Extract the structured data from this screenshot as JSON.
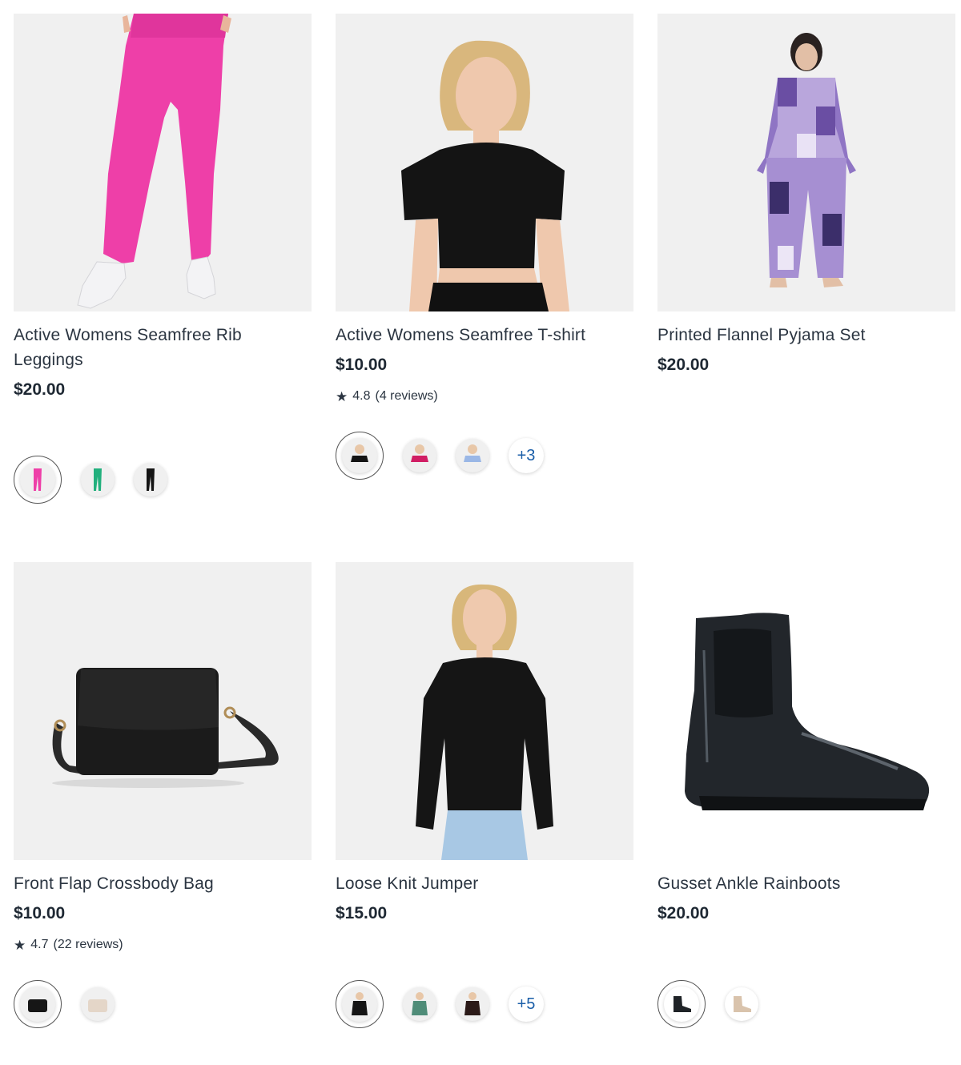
{
  "products": [
    {
      "title": "Active Womens Seamfree Rib Leggings",
      "price": "$20.00",
      "image": "pink-leggings-image",
      "swatches": [
        "pink",
        "green",
        "black"
      ]
    },
    {
      "title": "Active Womens Seamfree T-shirt",
      "price": "$10.00",
      "rating": "4.8",
      "reviews": "(4 reviews)",
      "image": "black-tshirt-image",
      "swatches": [
        "black",
        "magenta",
        "light-blue"
      ],
      "more": "+3"
    },
    {
      "title": "Printed Flannel Pyjama Set",
      "price": "$20.00",
      "image": "purple-pyjama-image"
    },
    {
      "title": "Front Flap Crossbody Bag",
      "price": "$10.00",
      "rating": "4.7",
      "reviews": "(22 reviews)",
      "image": "black-bag-image",
      "swatches": [
        "black",
        "cream"
      ]
    },
    {
      "title": "Loose Knit Jumper",
      "price": "$15.00",
      "image": "black-jumper-image",
      "swatches": [
        "black",
        "green",
        "dark-brown"
      ],
      "more": "+5"
    },
    {
      "title": "Gusset Ankle Rainboots",
      "price": "$20.00",
      "image": "black-rainboot-image",
      "swatches": [
        "black",
        "beige"
      ]
    }
  ],
  "colors": {
    "text": "#2b3541",
    "price": "#1e2833",
    "link_blue": "#1a5ea8",
    "image_bg": "#f0f0f0"
  }
}
